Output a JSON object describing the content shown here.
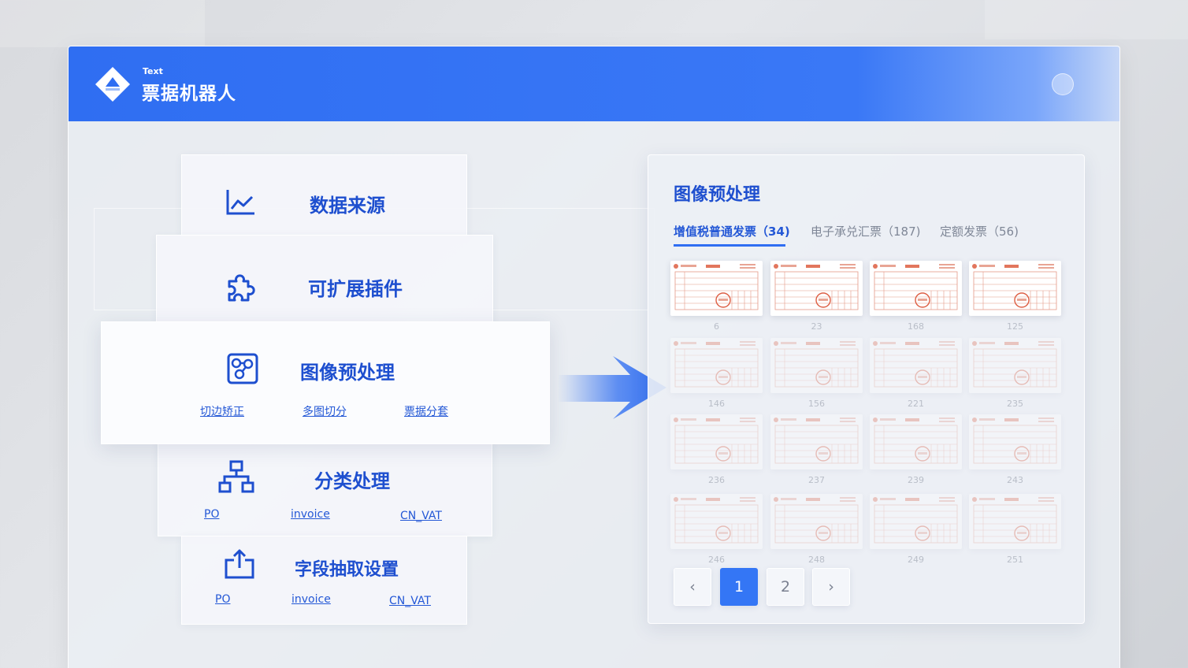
{
  "app": {
    "subtitle": "Text",
    "title": "票据机器人"
  },
  "steps": [
    {
      "title": "数据来源",
      "icon": "line-chart-icon",
      "links": []
    },
    {
      "title": "可扩展插件",
      "icon": "puzzle-icon",
      "links": []
    },
    {
      "title": "图像预处理",
      "icon": "image-process-icon",
      "links": [
        "切边矫正",
        "多图切分",
        "票据分套"
      ]
    },
    {
      "title": "分类处理",
      "icon": "hierarchy-icon",
      "links": [
        "PO",
        "invoice",
        "CN_VAT"
      ]
    },
    {
      "title": "字段抽取设置",
      "icon": "upload-tray-icon",
      "links": [
        "PO",
        "invoice",
        "CN_VAT"
      ]
    }
  ],
  "panel": {
    "title": "图像预处理",
    "tabs": [
      {
        "label": "增值税普通发票（34)",
        "active": true
      },
      {
        "label": "电子承兑汇票（187)",
        "active": false
      },
      {
        "label": "定额发票（56)",
        "active": false
      }
    ],
    "thumbnails": [
      "6",
      "23",
      "168",
      "125",
      "146",
      "156",
      "221",
      "235",
      "236",
      "237",
      "239",
      "243",
      "246",
      "248",
      "249",
      "251"
    ],
    "pagination": {
      "prev": "‹",
      "pages": [
        "1",
        "2"
      ],
      "current": "1",
      "next": "›"
    }
  },
  "colors": {
    "brand": "#2f6ef2",
    "title": "#1e4fcf",
    "link": "#2458d6"
  }
}
